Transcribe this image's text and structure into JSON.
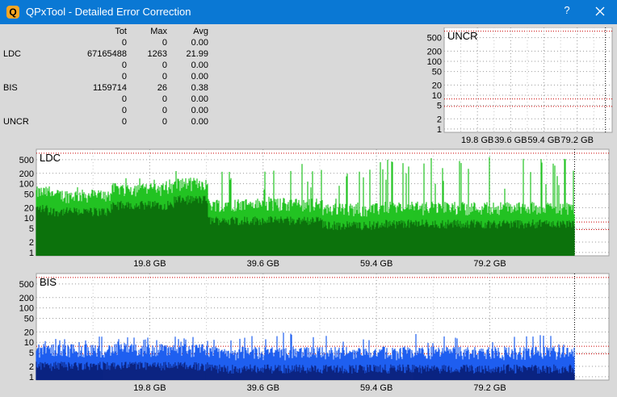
{
  "window": {
    "title": "QPxTool - Detailed Error Correction",
    "app_icon": "Q",
    "help_label": "?",
    "close_icon": "close-icon"
  },
  "stats": {
    "headers": [
      "",
      "Tot",
      "Max",
      "Avg"
    ],
    "rows": [
      [
        "",
        "0",
        "0",
        "0.00"
      ],
      [
        "LDC",
        "67165488",
        "1263",
        "21.99"
      ],
      [
        "",
        "0",
        "0",
        "0.00"
      ],
      [
        "",
        "0",
        "0",
        "0.00"
      ],
      [
        "BIS",
        "1159714",
        "26",
        "0.38"
      ],
      [
        "",
        "0",
        "0",
        "0.00"
      ],
      [
        "",
        "0",
        "0",
        "0.00"
      ],
      [
        "UNCR",
        "0",
        "0",
        "0.00"
      ]
    ]
  },
  "colors": {
    "titlebar": "#0a78d4",
    "ldc_bright": "#22c322",
    "ldc_dark": "#0b6b0b",
    "bis_bright": "#1e5ff0",
    "bis_dark": "#0a1f78",
    "grid_red": "#cc0000"
  },
  "chart_data": [
    {
      "name": "UNCR",
      "type": "area",
      "y_scale": "log",
      "y_ticks": [
        "500",
        "200",
        "100",
        "50",
        "20",
        "10",
        "5",
        "2",
        "1"
      ],
      "x_ticks": [
        "19.8 GB",
        "39.6 GB",
        "59.4 GB",
        "79.2 GB"
      ],
      "values": []
    },
    {
      "name": "LDC",
      "type": "area",
      "y_scale": "log",
      "y_ticks": [
        "500",
        "200",
        "100",
        "50",
        "20",
        "10",
        "5",
        "2",
        "1"
      ],
      "x_ticks": [
        "19.8 GB",
        "39.6 GB",
        "59.4 GB",
        "79.2 GB"
      ],
      "x_max_gb": 100,
      "segments": [
        {
          "x": [
            0,
            2
          ],
          "avg": 55,
          "max": 90
        },
        {
          "x": [
            2,
            13
          ],
          "avg": 45,
          "max": 100
        },
        {
          "x": [
            13,
            24
          ],
          "avg": 70,
          "max": 150
        },
        {
          "x": [
            24,
            30
          ],
          "avg": 100,
          "max": 300
        },
        {
          "x": [
            30,
            50
          ],
          "avg": 25,
          "max": 400
        },
        {
          "x": [
            50,
            60
          ],
          "avg": 18,
          "max": 300
        },
        {
          "x": [
            60,
            100
          ],
          "avg": 20,
          "max": 600
        }
      ]
    },
    {
      "name": "BIS",
      "type": "area",
      "y_scale": "log",
      "y_ticks": [
        "500",
        "200",
        "100",
        "50",
        "20",
        "10",
        "5",
        "2",
        "1"
      ],
      "x_ticks": [
        "19.8 GB",
        "39.6 GB",
        "59.4 GB",
        "79.2 GB"
      ],
      "x_max_gb": 100,
      "segments": [
        {
          "x": [
            0,
            30
          ],
          "avg": 6,
          "max": 15
        },
        {
          "x": [
            30,
            100
          ],
          "avg": 5,
          "max": 20
        }
      ]
    }
  ]
}
